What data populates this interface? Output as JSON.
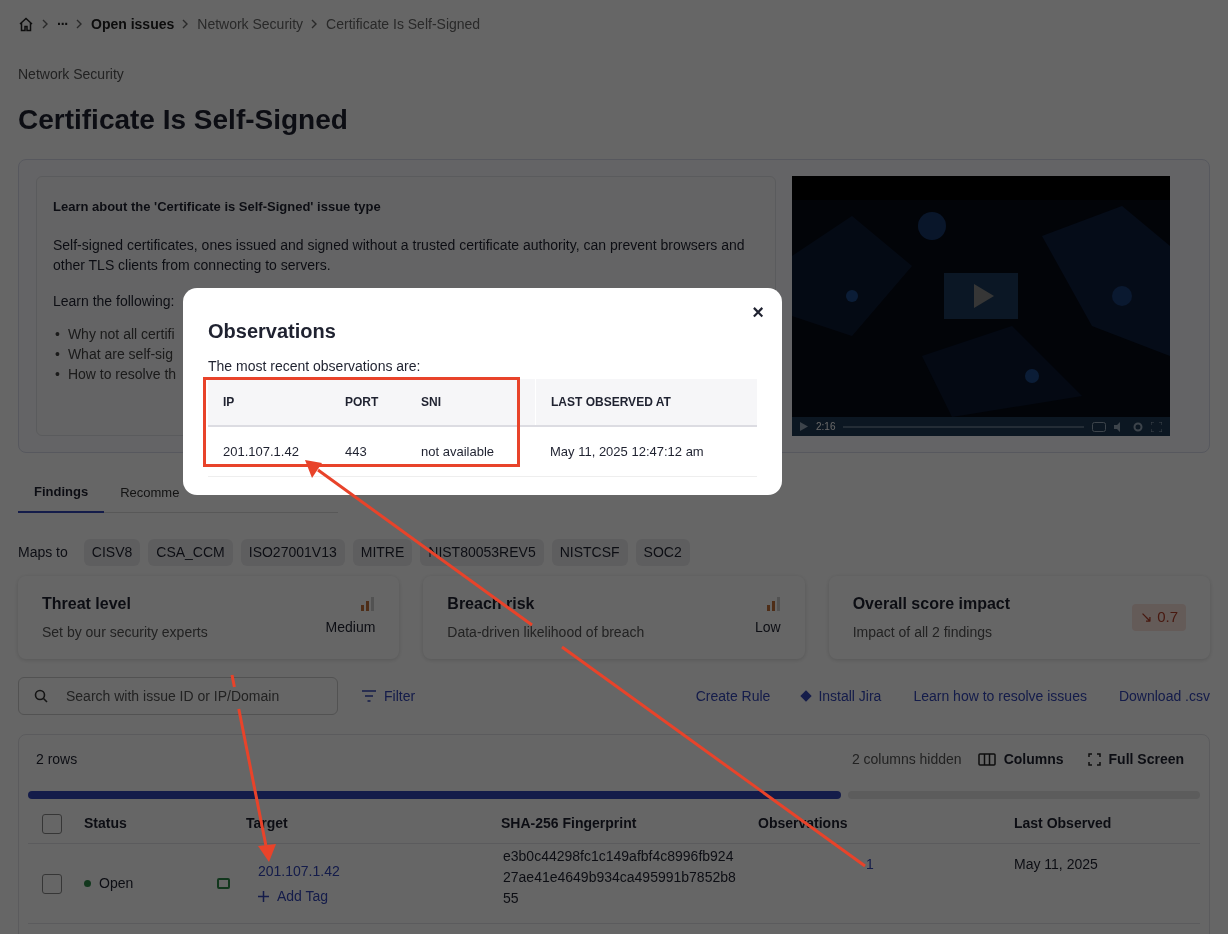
{
  "breadcrumb": [
    {
      "label": "···",
      "kind": "overflow"
    },
    {
      "label": "Open issues",
      "kind": "root"
    },
    {
      "label": "Network Security",
      "kind": "link"
    },
    {
      "label": "Certificate Is Self-Signed",
      "kind": "page"
    }
  ],
  "category": "Network Security",
  "title": "Certificate Is Self-Signed",
  "learn": {
    "heading": "Learn about the 'Certificate is Self-Signed' issue type",
    "paragraph": "Self-signed certificates, ones issued and signed without a trusted certificate authority, can prevent browsers and other TLS clients from connecting to servers.",
    "list_intro": "Learn the following:",
    "bullets": [
      {
        "marker": "•",
        "text": "Why not all certifi"
      },
      {
        "marker": "•",
        "text": "What are self-sig"
      },
      {
        "marker": "•",
        "text": "How to resolve th"
      }
    ]
  },
  "video": {
    "time": "2:16"
  },
  "tabs": [
    {
      "label": "Findings",
      "selected": true
    },
    {
      "label": "Recomme",
      "selected": false
    }
  ],
  "maps_to": {
    "label": "Maps to",
    "tags": [
      "CISV8",
      "CSA_CCM",
      "ISO27001V13",
      "MITRE",
      "NIST80053REV5",
      "NISTCSF",
      "SOC2"
    ]
  },
  "cards": [
    {
      "kind": "rating",
      "title": "Threat level",
      "subtitle": "Set by our security experts",
      "value": "Medium"
    },
    {
      "kind": "rating",
      "title": "Breach risk",
      "subtitle": "Data-driven likelihood of breach",
      "value": "Low"
    },
    {
      "kind": "impact",
      "title": "Overall score impact",
      "subtitle": "Impact of all 2 findings",
      "value": "↘ 0.7"
    }
  ],
  "search": {
    "placeholder": "Search with issue ID or IP/Domain"
  },
  "filter": "Filter",
  "actions": [
    {
      "label": "Create Rule",
      "kind": "link"
    },
    {
      "label": "Install Jira",
      "kind": "integration"
    },
    {
      "label": "Learn how to resolve issues",
      "kind": "link"
    },
    {
      "label": "Download .csv",
      "kind": "link"
    }
  ],
  "table": {
    "all_checked": false,
    "row_count": "2 rows",
    "hidden": "2 columns hidden",
    "columns_button": "Columns",
    "fullscreen_button": "Full Screen",
    "columns": [
      "Status",
      "Target",
      "SHA-256 Fingerprint",
      "Observations",
      "Last Observed"
    ],
    "rows": [
      {
        "checked": false,
        "status": "Open",
        "target": "201.107.1.42",
        "add_tag": "Add Tag",
        "fingerprint": "e3b0c44298fc1c149afbf4c8996fb92427ae41e4649b934ca495991b7852b855",
        "observations": "1",
        "last_observed": "May 11, 2025"
      }
    ]
  },
  "modal": {
    "title": "Observations",
    "close": "×",
    "intro": "The most recent observations are:",
    "columns": [
      "IP",
      "PORT",
      "SNI",
      "LAST OBSERVED AT"
    ],
    "rows": [
      [
        "201.107.1.42",
        "443",
        "not available",
        "May 11, 2025 12:47:12 am"
      ]
    ]
  }
}
